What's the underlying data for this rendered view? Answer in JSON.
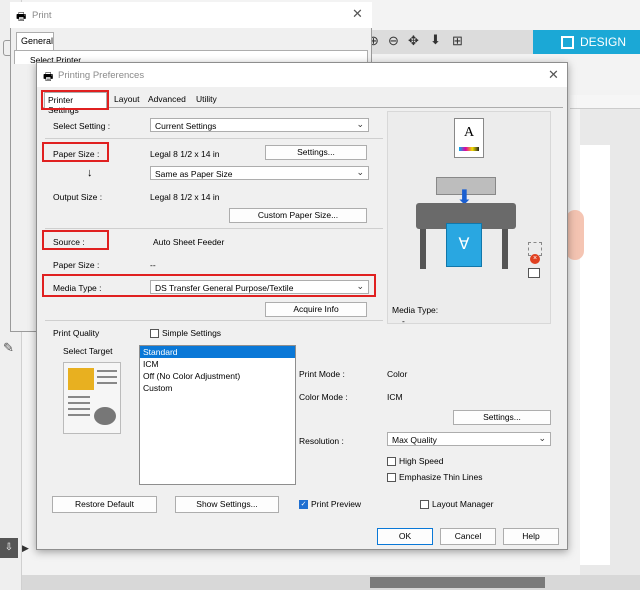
{
  "background_app": {
    "design_tab": "DESIGN",
    "accent_color": "#1ba8d6"
  },
  "print_window": {
    "title": "Print",
    "tab": "General",
    "partial_text": "Select Printer"
  },
  "dialog": {
    "title": "Printing Preferences",
    "tabs": [
      "Printer Settings",
      "Layout",
      "Advanced",
      "Utility"
    ],
    "select_setting": {
      "label": "Select Setting :",
      "value": "Current Settings"
    },
    "paper_size": {
      "label": "Paper Size :",
      "value": "Legal 8 1/2 x 14 in",
      "button": "Settings..."
    },
    "paper_size_mode": {
      "arrow": "↓",
      "value": "Same as Paper Size"
    },
    "output_size": {
      "label": "Output Size :",
      "value": "Legal 8 1/2 x 14 in",
      "button": "Custom Paper Size..."
    },
    "source": {
      "label": "Source :",
      "value": "Auto Sheet Feeder"
    },
    "source_paper_size": {
      "label": "Paper Size :",
      "value": "--"
    },
    "media_type": {
      "label": "Media Type :",
      "value": "DS Transfer General Purpose/Textile",
      "button": "Acquire Info"
    },
    "print_quality": {
      "label": "Print Quality",
      "simple_settings": "Simple Settings",
      "select_target": "Select Target",
      "targets": [
        "Standard",
        "ICM",
        "Off (No Color Adjustment)",
        "Custom"
      ],
      "selected_index": 0
    },
    "preview": {
      "media_type_label": "Media Type:",
      "media_type_value": "-",
      "paper_letter": "A"
    },
    "print_mode": {
      "label": "Print Mode :",
      "value": "Color"
    },
    "color_mode": {
      "label": "Color Mode :",
      "value": "ICM",
      "button": "Settings..."
    },
    "resolution": {
      "label": "Resolution :",
      "value": "Max Quality"
    },
    "high_speed": "High Speed",
    "emphasize_thin_lines": "Emphasize Thin Lines",
    "restore_default": "Restore Default",
    "show_settings": "Show Settings...",
    "print_preview": {
      "label": "Print Preview",
      "checked": true
    },
    "layout_manager": {
      "label": "Layout Manager",
      "checked": false
    },
    "ok": "OK",
    "cancel": "Cancel",
    "help": "Help"
  },
  "colors": {
    "highlight": "#e02020",
    "selection": "#0a78d7"
  }
}
